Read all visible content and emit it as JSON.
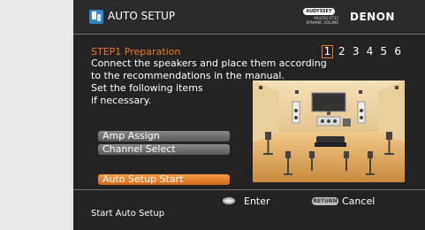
{
  "header": {
    "app_icon": "speaker-setup-icon",
    "title": "AUTO SETUP",
    "audyssey_badge": "AUDYSSEY",
    "audyssey_sub": "MULTEQ XT32",
    "audyssey_sub2": "DYNAMIC VOLUME",
    "brand": "DENON"
  },
  "step": {
    "title": "STEP1 Preparation",
    "current": 1,
    "numbers": [
      "1",
      "2",
      "3",
      "4",
      "5",
      "6"
    ]
  },
  "description": {
    "line1": "Connect the speakers and place them according",
    "line2": "to the recommendations in the manual.",
    "line3": "Set the following items",
    "line4": "if necessary."
  },
  "menu": {
    "amp_assign": "Amp Assign",
    "channel_select": "Channel Select",
    "auto_setup_start": "Auto Setup Start"
  },
  "footer": {
    "enter_icon": "enter-button-icon",
    "enter_label": "Enter",
    "return_badge": "RETURN",
    "cancel_label": "Cancel",
    "hint": "Start Auto Setup"
  },
  "colors": {
    "accent": "#e8772a",
    "screen_bg": "#232323",
    "page_bg": "#e9e9e9",
    "selected_btn": "#e8772a",
    "unselected_btn": "#707070"
  }
}
